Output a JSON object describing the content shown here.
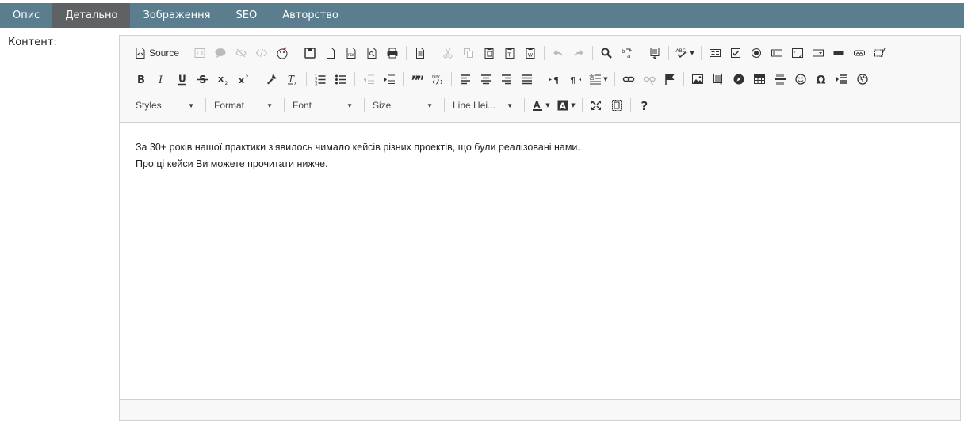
{
  "tabs": [
    {
      "label": "Опис"
    },
    {
      "label": "Детально"
    },
    {
      "label": "Зображення"
    },
    {
      "label": "SEO"
    },
    {
      "label": "Авторство"
    }
  ],
  "field_label": "Контент:",
  "editor": {
    "source_label": "Source",
    "combos": {
      "styles": "Styles",
      "format": "Format",
      "font": "Font",
      "size": "Size",
      "line_height": "Line Hei..."
    },
    "content_lines": [
      "За 30+ років нашої практики з'явилось чимало кейсів різних проектів, що були реалізовані нами.",
      "Про ці кейси Ви можете прочитати нижче."
    ]
  },
  "colors": {
    "tab_bar": "#5b7e8e",
    "tab_active": "#5e6265",
    "toolbar_bg": "#f8f8f8",
    "border": "#d1d1d1"
  }
}
